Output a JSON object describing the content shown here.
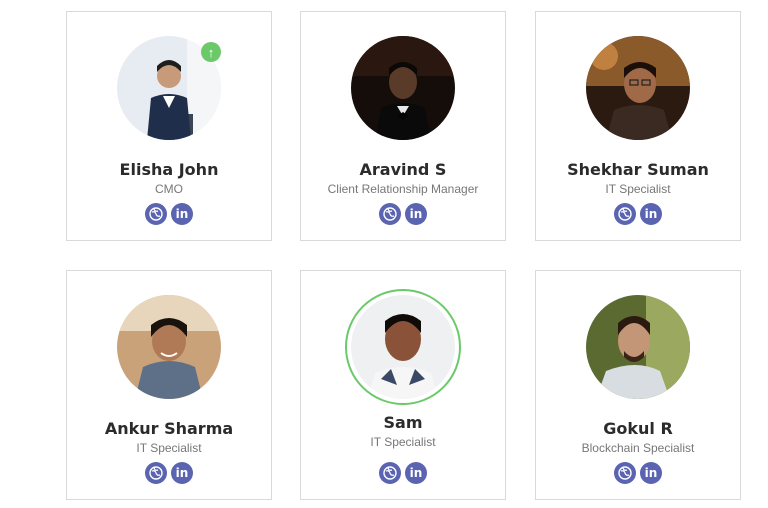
{
  "team": [
    {
      "name": "Elisha John",
      "role": "CMO"
    },
    {
      "name": "Aravind S",
      "role": "Client Relationship Manager"
    },
    {
      "name": "Shekhar Suman",
      "role": "IT Specialist"
    },
    {
      "name": "Ankur Sharma",
      "role": "IT Specialist"
    },
    {
      "name": "Sam",
      "role": "IT Specialist"
    },
    {
      "name": "Gokul R",
      "role": "Blockchain Specialist"
    }
  ],
  "icons": {
    "website": "globe-icon",
    "linkedin": "linkedin-icon",
    "linkedin_text": "in",
    "upload": "arrow-up-icon",
    "upload_glyph": "↑"
  },
  "colors": {
    "social_bg": "#5a64b0",
    "highlight_green": "#6cc96a"
  }
}
